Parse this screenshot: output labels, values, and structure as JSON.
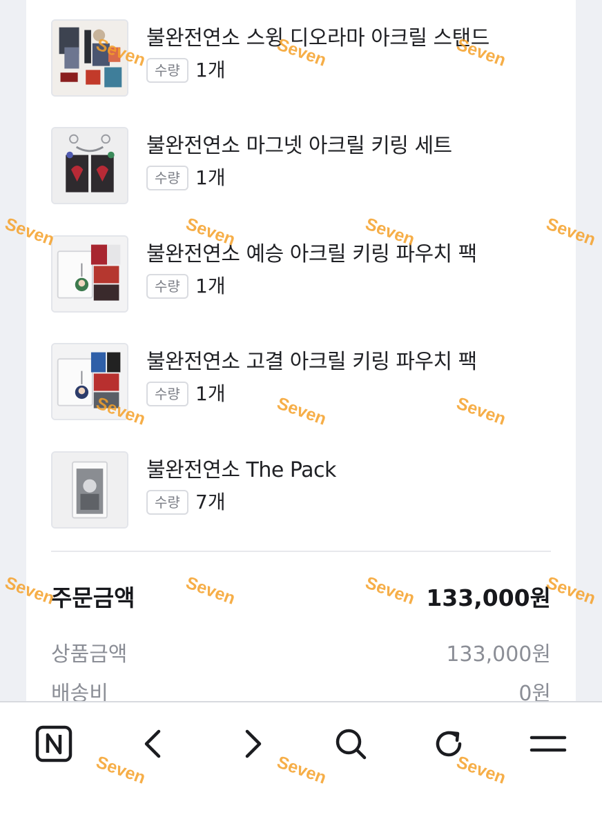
{
  "order_items": [
    {
      "name": "불완전연소 스윙 디오라마 아크릴 스탠드",
      "qty_label": "수량",
      "qty": "1개",
      "thumb_icon": "acrylic-stand-thumbnail"
    },
    {
      "name": "불완전연소 마그넷 아크릴 키링 세트",
      "qty_label": "수량",
      "qty": "1개",
      "thumb_icon": "magnet-keyring-thumbnail"
    },
    {
      "name": "불완전연소 예승 아크릴 키링 파우치 팩",
      "qty_label": "수량",
      "qty": "1개",
      "thumb_icon": "pouch-pack-thumbnail"
    },
    {
      "name": "불완전연소 고결 아크릴 키링 파우치 팩",
      "qty_label": "수량",
      "qty": "1개",
      "thumb_icon": "pouch-pack-thumbnail"
    },
    {
      "name": "불완전연소 The Pack",
      "qty_label": "수량",
      "qty": "7개",
      "thumb_icon": "the-pack-thumbnail"
    }
  ],
  "summary": {
    "total_label": "주문금액",
    "total_value": "133,000원",
    "subtotal_label": "상품금액",
    "subtotal_value": "133,000원",
    "shipping_label": "배송비",
    "shipping_value": "0원"
  },
  "toolbar": {
    "buttons": [
      "naver-home-icon",
      "back-icon",
      "forward-icon",
      "search-icon",
      "refresh-icon",
      "menu-icon"
    ]
  },
  "watermark": "Seven",
  "colors": {
    "background": "#eef0f4",
    "sheet": "#ffffff",
    "watermark": "#f5a028",
    "muted_text": "#8b8e96"
  }
}
